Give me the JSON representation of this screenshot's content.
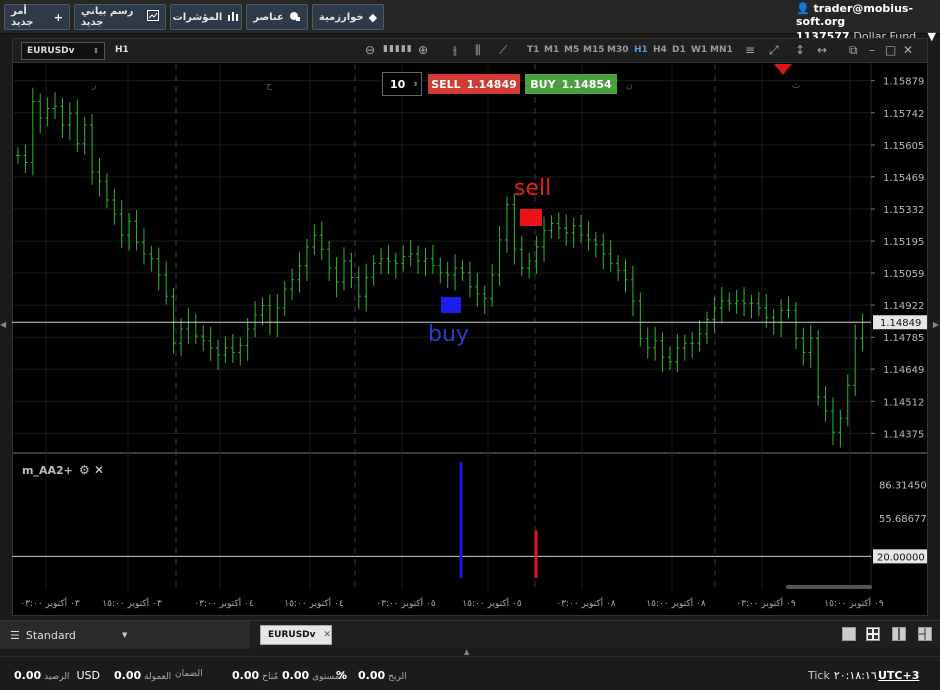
{
  "topbar": {
    "buttons": [
      {
        "label": "أمر جديد",
        "icon": "plus-icon"
      },
      {
        "label": "رسم بياني جديد",
        "icon": "chart-icon"
      },
      {
        "label": "المؤشرات",
        "icon": "bars-icon"
      },
      {
        "label": "عناصر",
        "icon": "elements-icon"
      },
      {
        "label": "خوارزمية",
        "icon": "diamond-icon"
      }
    ],
    "account_email": "trader@mobius-soft.org",
    "account_id": "1137577",
    "account_type": "Dollar Fund"
  },
  "chart": {
    "symbol": "EURUSDv",
    "timeframe": "H1",
    "timeframes": [
      "T1",
      "M1",
      "M5",
      "M15",
      "M30",
      "H1",
      "H4",
      "D1",
      "W1",
      "MN1"
    ],
    "active_timeframe": "H1",
    "trade": {
      "quantity": "10",
      "sell_label": "SELL",
      "sell_price": "1.14849",
      "buy_label": "BUY",
      "buy_price": "1.14854"
    },
    "signals": {
      "buy": "buy",
      "sell": "sell"
    },
    "indicator": {
      "name": "m_AA2+"
    }
  },
  "chart_data": {
    "type": "candlestick",
    "symbol": "EURUSDv",
    "price_ticks": [
      "1.15879",
      "1.15742",
      "1.15605",
      "1.15469",
      "1.15332",
      "1.15195",
      "1.15059",
      "1.14922",
      "1.14785",
      "1.14649",
      "1.14512",
      "1.14375"
    ],
    "price_tick_values": [
      1.15879,
      1.15742,
      1.15605,
      1.15469,
      1.15332,
      1.15195,
      1.15059,
      1.14922,
      1.14785,
      1.14649,
      1.14512,
      1.14375
    ],
    "ylim": [
      1.143,
      1.1595
    ],
    "current_price": "1.14849",
    "current_price_value": 1.14849,
    "closes": [
      1.1556,
      1.1553,
      1.1579,
      1.1572,
      1.1576,
      1.1577,
      1.1569,
      1.1574,
      1.1561,
      1.1569,
      1.1549,
      1.1545,
      1.1537,
      1.1531,
      1.1522,
      1.1528,
      1.1519,
      1.1514,
      1.1512,
      1.1505,
      1.1496,
      1.1476,
      1.1482,
      1.1485,
      1.1479,
      1.1477,
      1.1474,
      1.1471,
      1.1474,
      1.1472,
      1.1475,
      1.1482,
      1.1488,
      1.1492,
      1.1485,
      1.1491,
      1.1499,
      1.1503,
      1.1509,
      1.1517,
      1.1522,
      1.1516,
      1.1508,
      1.1502,
      1.1511,
      1.1504,
      1.1496,
      1.1504,
      1.151,
      1.1512,
      1.1511,
      1.151,
      1.1513,
      1.1514,
      1.1511,
      1.1512,
      1.1509,
      1.1506,
      1.1505,
      1.1508,
      1.1506,
      1.15,
      1.1497,
      1.1495,
      1.1505,
      1.152,
      1.1535,
      1.1516,
      1.1508,
      1.1511,
      1.1517,
      1.1524,
      1.1527,
      1.1525,
      1.1523,
      1.1526,
      1.1522,
      1.152,
      1.1518,
      1.1514,
      1.151,
      1.1507,
      1.1503,
      1.1494,
      1.1478,
      1.1474,
      1.1477,
      1.147,
      1.1468,
      1.1474,
      1.1476,
      1.1476,
      1.148,
      1.1486,
      1.1491,
      1.1494,
      1.1493,
      1.1494,
      1.1493,
      1.1493,
      1.1491,
      1.1487,
      1.1485,
      1.149,
      1.149,
      1.1478,
      1.1472,
      1.1478,
      1.1453,
      1.1447,
      1.1438,
      1.1444,
      1.1458,
      1.1478,
      1.1485
    ],
    "indicator": {
      "name": "m_AA2+",
      "ticks": [
        "86.31450",
        "55.68677",
        "20.00000"
      ],
      "tick_values": [
        86.3145,
        55.68677,
        20.0
      ],
      "ylim": [
        0,
        110
      ],
      "level": "20.00000",
      "level_value": 20.0,
      "bars": [
        {
          "type": "buy",
          "color": "#1a1ae6",
          "value": 107
        },
        {
          "type": "sell",
          "color": "#e6141a",
          "value": 44
        }
      ]
    },
    "time_labels": [
      "٠٣ أكتوبر ٠٣:٠٠",
      "٠٣ أكتوبر ١٥:٠٠",
      "٠٤ أكتوبر ٠٣:٠٠",
      "٠٤ أكتوبر ١٥:٠٠",
      "٠٥ أكتوبر ٠٣:٠٠",
      "٠٥ أكتوبر ١٥:٠٠",
      "٠٨ أكتوبر ٠٣:٠٠",
      "٠٨ أكتوبر ١٥:٠٠",
      "٠٩ أكتوبر ٠٣:٠٠",
      "٠٩ أكتوبر ١٥:٠٠"
    ],
    "day_markers": [
      "ر",
      "خ",
      "ج",
      "ن",
      "ث"
    ]
  },
  "tabs": {
    "layout": "Standard",
    "symbol_tab": "EURUSDv"
  },
  "status": {
    "balance_value": "0.00",
    "currency": "USD",
    "balance_label": "الرصيد",
    "commission_value": "0.00",
    "commission_label": "العمولة",
    "margin_value": "0.00",
    "margin_label": "الضمان",
    "available_value": "0.00",
    "available_label": "مُتاح",
    "level_value": "%",
    "level_label": "المستوى",
    "profit_value": "0.00",
    "profit_label": "الربح",
    "tick_label": "Tick",
    "tick_time": "٢٠:١٨:١٦",
    "utc": "UTC+3"
  }
}
